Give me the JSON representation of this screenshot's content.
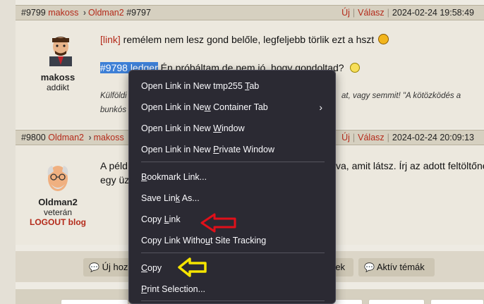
{
  "post1": {
    "header_id": "#9799",
    "header_user": "makoss",
    "header_reply_to_user": "Oldman2",
    "header_reply_to_id": "#9797",
    "new_label": "Új",
    "reply_label": "Válasz",
    "timestamp": "2024-02-24 19:58:49",
    "author_name": "makoss",
    "author_rank": "addikt",
    "line1_link": "[link]",
    "line1_text": " remélem nem lesz gond belőle, legfeljebb törlik ezt a hszt",
    "line2_selected": "#9798 ledger",
    "line2_text": " Én próbáltam de nem jó, hogy gondoltad?",
    "sig_line1_start": "Külföldi",
    "sig_line1_end": "at, vagy semmit! \"A kötözködés a",
    "sig_line2_start": "bunkós"
  },
  "post2": {
    "header_id": "#9800",
    "header_user": "Oldman2",
    "header_reply_to_user": "makoss",
    "new_label": "Új",
    "reply_label": "Válasz",
    "timestamp": "2024-02-24 20:09:13",
    "author_name": "Oldman2",
    "author_rank": "veterán",
    "author_blog": "LOGOUT blog",
    "line1_start": "A péld",
    "line1_end": "va, amit látsz. Írj az adott feltöltőnek",
    "line2_start": "egy üz"
  },
  "toolbar": {
    "new_topic": "Új hoz",
    "latest": "rek",
    "active_topics": "Aktív témák"
  },
  "context_menu": {
    "items": [
      {
        "pre": "Open Link in New tmp255 ",
        "acc": "T",
        "post": "ab"
      },
      {
        "pre": "Open Link in Ne",
        "acc": "w",
        "post": " Container Tab"
      },
      {
        "pre": "Open Link in New ",
        "acc": "W",
        "post": "indow"
      },
      {
        "pre": "Open Link in New ",
        "acc": "P",
        "post": "rivate Window"
      },
      {
        "pre": "",
        "acc": "B",
        "post": "ookmark Link..."
      },
      {
        "pre": "Save Lin",
        "acc": "k",
        "post": " As..."
      },
      {
        "pre": "Copy ",
        "acc": "L",
        "post": "ink"
      },
      {
        "pre": "Copy Link Witho",
        "acc": "u",
        "post": "t Site Tracking"
      },
      {
        "pre": "",
        "acc": "C",
        "post": "opy"
      },
      {
        "pre": "",
        "acc": "P",
        "post": "rint Selection..."
      }
    ]
  },
  "colors": {
    "accent_red": "#b42a1a",
    "menu_bg": "#2b2a33",
    "selection": "#3d7fd6",
    "annotation_red_arrow": "#e0101a",
    "annotation_yellow_arrow": "#f5e400"
  }
}
